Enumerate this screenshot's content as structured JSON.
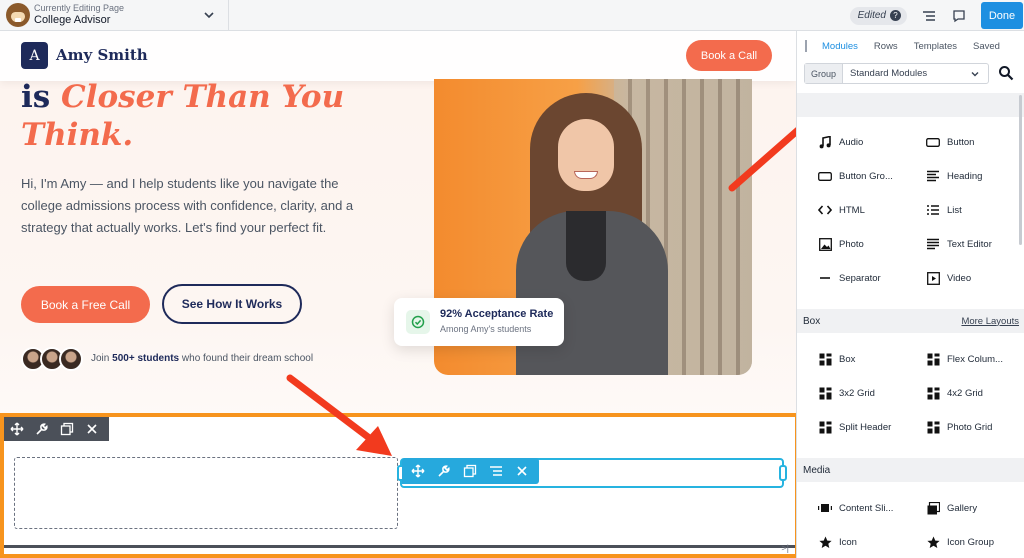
{
  "topbar": {
    "editing_label": "Currently Editing Page",
    "page_title": "College Advisor",
    "status": "Edited",
    "done_label": "Done"
  },
  "site": {
    "brand_initial": "A",
    "brand_name": "Amy Smith",
    "header_cta": "Book a Call",
    "hero_prefix": "is",
    "hero_accent_1": "Closer Than You",
    "hero_accent_2": "Think.",
    "hero_body": "Hi, I'm Amy — and I help students like you navigate the college admissions process with confidence, clarity, and a strategy that actually works. Let's find your perfect fit.",
    "primary_cta": "Book a Free Call",
    "secondary_cta": "See How It Works",
    "social_pre": "Join",
    "social_bold": "500+ students",
    "social_post": "who found their dream school",
    "stat_title": "92% Acceptance Rate",
    "stat_sub": "Among Amy's students"
  },
  "panel": {
    "tabs": [
      "Modules",
      "Rows",
      "Templates",
      "Saved"
    ],
    "group_label": "Group",
    "group_value": "Standard Modules",
    "standard_modules": [
      {
        "label": "Audio",
        "icon": "music-note-icon"
      },
      {
        "label": "Button",
        "icon": "button-icon"
      },
      {
        "label": "Button Gro...",
        "icon": "button-group-icon"
      },
      {
        "label": "Heading",
        "icon": "heading-icon"
      },
      {
        "label": "HTML",
        "icon": "code-icon"
      },
      {
        "label": "List",
        "icon": "list-icon"
      },
      {
        "label": "Photo",
        "icon": "photo-icon"
      },
      {
        "label": "Text Editor",
        "icon": "text-editor-icon"
      },
      {
        "label": "Separator",
        "icon": "separator-icon"
      },
      {
        "label": "Video",
        "icon": "video-icon"
      }
    ],
    "box_section": "Box",
    "more_layouts": "More Layouts",
    "box_modules": [
      {
        "label": "Box",
        "icon": "box-icon"
      },
      {
        "label": "Flex Colum...",
        "icon": "flex-columns-icon"
      },
      {
        "label": "3x2 Grid",
        "icon": "grid-3x2-icon"
      },
      {
        "label": "4x2 Grid",
        "icon": "grid-4x2-icon"
      },
      {
        "label": "Split Header",
        "icon": "split-header-icon"
      },
      {
        "label": "Photo Grid",
        "icon": "photo-grid-icon"
      }
    ],
    "media_section": "Media",
    "media_modules": [
      {
        "label": "Content Sli...",
        "icon": "content-slider-icon"
      },
      {
        "label": "Gallery",
        "icon": "gallery-icon"
      },
      {
        "label": "Icon",
        "icon": "star-icon"
      },
      {
        "label": "Icon Group",
        "icon": "star-icon"
      }
    ]
  },
  "colors": {
    "accent": "#f36b4d",
    "navy": "#1e2a5a",
    "builder_blue": "#1d8fe1",
    "row_highlight": "#f7941d",
    "module_highlight": "#26b3e0",
    "annotation_arrow": "#f23a1e"
  }
}
